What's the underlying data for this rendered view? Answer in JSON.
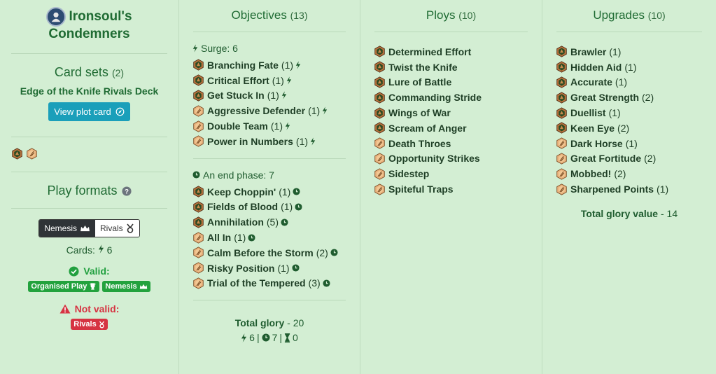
{
  "warband": {
    "name_line1": "Ironsoul's",
    "name_line2": "Condemners"
  },
  "card_sets": {
    "title": "Card sets",
    "count": "(2)",
    "set_name": "Edge of the Knife Rivals Deck",
    "plot_button": "View plot card"
  },
  "factions": [
    "warband-faction-icon",
    "universal-faction-icon"
  ],
  "play_formats": {
    "title": "Play formats",
    "options": [
      "Nemesis",
      "Rivals"
    ],
    "selected": "Nemesis",
    "cards_label": "Cards:",
    "cards_value": "6",
    "valid_label": "Valid:",
    "valid_badges": [
      "Organised Play",
      "Nemesis"
    ],
    "invalid_label": "Not valid:",
    "invalid_badges": [
      "Rivals"
    ]
  },
  "objectives": {
    "title": "Objectives",
    "count": "(13)",
    "surge_label": "Surge: 6",
    "surge": [
      {
        "name": "Branching Fate",
        "qty": "(1)",
        "faction": "warband"
      },
      {
        "name": "Critical Effort",
        "qty": "(1)",
        "faction": "warband"
      },
      {
        "name": "Get Stuck In",
        "qty": "(1)",
        "faction": "warband"
      },
      {
        "name": "Aggressive Defender",
        "qty": "(1)",
        "faction": "universal"
      },
      {
        "name": "Double Team",
        "qty": "(1)",
        "faction": "universal"
      },
      {
        "name": "Power in Numbers",
        "qty": "(1)",
        "faction": "universal"
      }
    ],
    "end_label": "An end phase: 7",
    "end_phase": [
      {
        "name": "Keep Choppin'",
        "qty": "(1)",
        "faction": "warband"
      },
      {
        "name": "Fields of Blood",
        "qty": "(1)",
        "faction": "warband"
      },
      {
        "name": "Annihilation",
        "qty": "(5)",
        "faction": "warband"
      },
      {
        "name": "All In",
        "qty": "(1)",
        "faction": "universal"
      },
      {
        "name": "Calm Before the Storm",
        "qty": "(2)",
        "faction": "universal"
      },
      {
        "name": "Risky Position",
        "qty": "(1)",
        "faction": "universal"
      },
      {
        "name": "Trial of the Tempered",
        "qty": "(3)",
        "faction": "universal"
      }
    ],
    "total_label": "Total glory",
    "total_value": "20",
    "surge_count": "6",
    "end_count": "7",
    "third_count": "0"
  },
  "ploys": {
    "title": "Ploys",
    "count": "(10)",
    "items": [
      {
        "name": "Determined Effort",
        "faction": "warband"
      },
      {
        "name": "Twist the Knife",
        "faction": "warband"
      },
      {
        "name": "Lure of Battle",
        "faction": "warband"
      },
      {
        "name": "Commanding Stride",
        "faction": "warband"
      },
      {
        "name": "Wings of War",
        "faction": "warband"
      },
      {
        "name": "Scream of Anger",
        "faction": "warband"
      },
      {
        "name": "Death Throes",
        "faction": "universal"
      },
      {
        "name": "Opportunity Strikes",
        "faction": "universal"
      },
      {
        "name": "Sidestep",
        "faction": "universal"
      },
      {
        "name": "Spiteful Traps",
        "faction": "universal"
      }
    ]
  },
  "upgrades": {
    "title": "Upgrades",
    "count": "(10)",
    "items": [
      {
        "name": "Brawler",
        "qty": "(1)",
        "faction": "warband"
      },
      {
        "name": "Hidden Aid",
        "qty": "(1)",
        "faction": "warband"
      },
      {
        "name": "Accurate",
        "qty": "(1)",
        "faction": "warband"
      },
      {
        "name": "Great Strength",
        "qty": "(2)",
        "faction": "warband"
      },
      {
        "name": "Duellist",
        "qty": "(1)",
        "faction": "warband"
      },
      {
        "name": "Keen Eye",
        "qty": "(2)",
        "faction": "warband"
      },
      {
        "name": "Dark Horse",
        "qty": "(1)",
        "faction": "universal"
      },
      {
        "name": "Great Fortitude",
        "qty": "(2)",
        "faction": "universal"
      },
      {
        "name": "Mobbed!",
        "qty": "(2)",
        "faction": "universal"
      },
      {
        "name": "Sharpened Points",
        "qty": "(1)",
        "faction": "universal"
      }
    ],
    "total_label": "Total glory value",
    "total_value": "14"
  },
  "colors": {
    "background": "#d3eed3",
    "accent_green": "#1f6b33",
    "button_teal": "#1a9fba",
    "valid_green": "#22a23d",
    "invalid_red": "#d63342"
  }
}
